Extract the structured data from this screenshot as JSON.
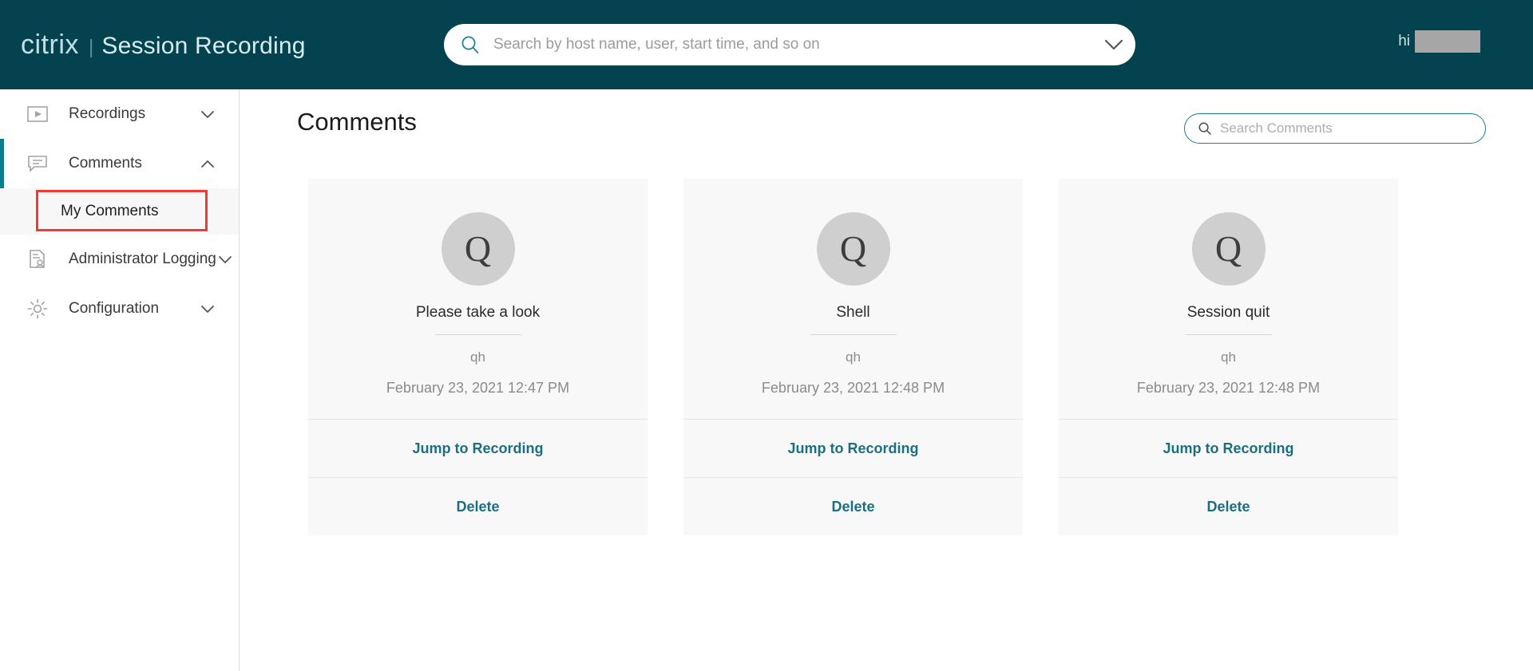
{
  "header": {
    "brand_name": "citrix",
    "brand_separator": "|",
    "app_name": "Session Recording",
    "search_placeholder": "Search by host name, user, start time, and so on",
    "search_value": "",
    "search_icon": "search-icon",
    "caret_icon": "chevron-down-icon",
    "greeting": "hi",
    "brand_color": "#04424f",
    "accent_color": "#1a7f8e"
  },
  "sidebar": {
    "items": [
      {
        "label": "Recordings",
        "icon": "play-square-icon",
        "chevron": "chevron-down-icon",
        "expanded": false,
        "active": false
      },
      {
        "label": "Comments",
        "icon": "comment-bubble-icon",
        "chevron": "chevron-up-icon",
        "expanded": true,
        "active": true
      },
      {
        "label": "Administrator Logging",
        "icon": "document-user-icon",
        "chevron": "chevron-down-icon",
        "expanded": false,
        "active": false
      },
      {
        "label": "Configuration",
        "icon": "gear-icon",
        "chevron": "chevron-down-icon",
        "expanded": false,
        "active": false
      }
    ],
    "sub_item": {
      "label": "My Comments",
      "highlighted": true,
      "highlight_color": "#ee3b35"
    },
    "active_indicator_color": "#0d7d8e"
  },
  "main": {
    "page_title": "Comments",
    "search": {
      "placeholder": "Search Comments",
      "value": "",
      "icon": "search-icon"
    },
    "cards": [
      {
        "avatar_letter": "Q",
        "title": "Please take a look",
        "user": "qh",
        "timestamp": "February 23, 2021 12:47 PM",
        "jump_label": "Jump to Recording",
        "delete_label": "Delete"
      },
      {
        "avatar_letter": "Q",
        "title": "Shell",
        "user": "qh",
        "timestamp": "February 23, 2021 12:48 PM",
        "jump_label": "Jump to Recording",
        "delete_label": "Delete"
      },
      {
        "avatar_letter": "Q",
        "title": "Session quit",
        "user": "qh",
        "timestamp": "February 23, 2021 12:48 PM",
        "jump_label": "Jump to Recording",
        "delete_label": "Delete"
      }
    ]
  }
}
